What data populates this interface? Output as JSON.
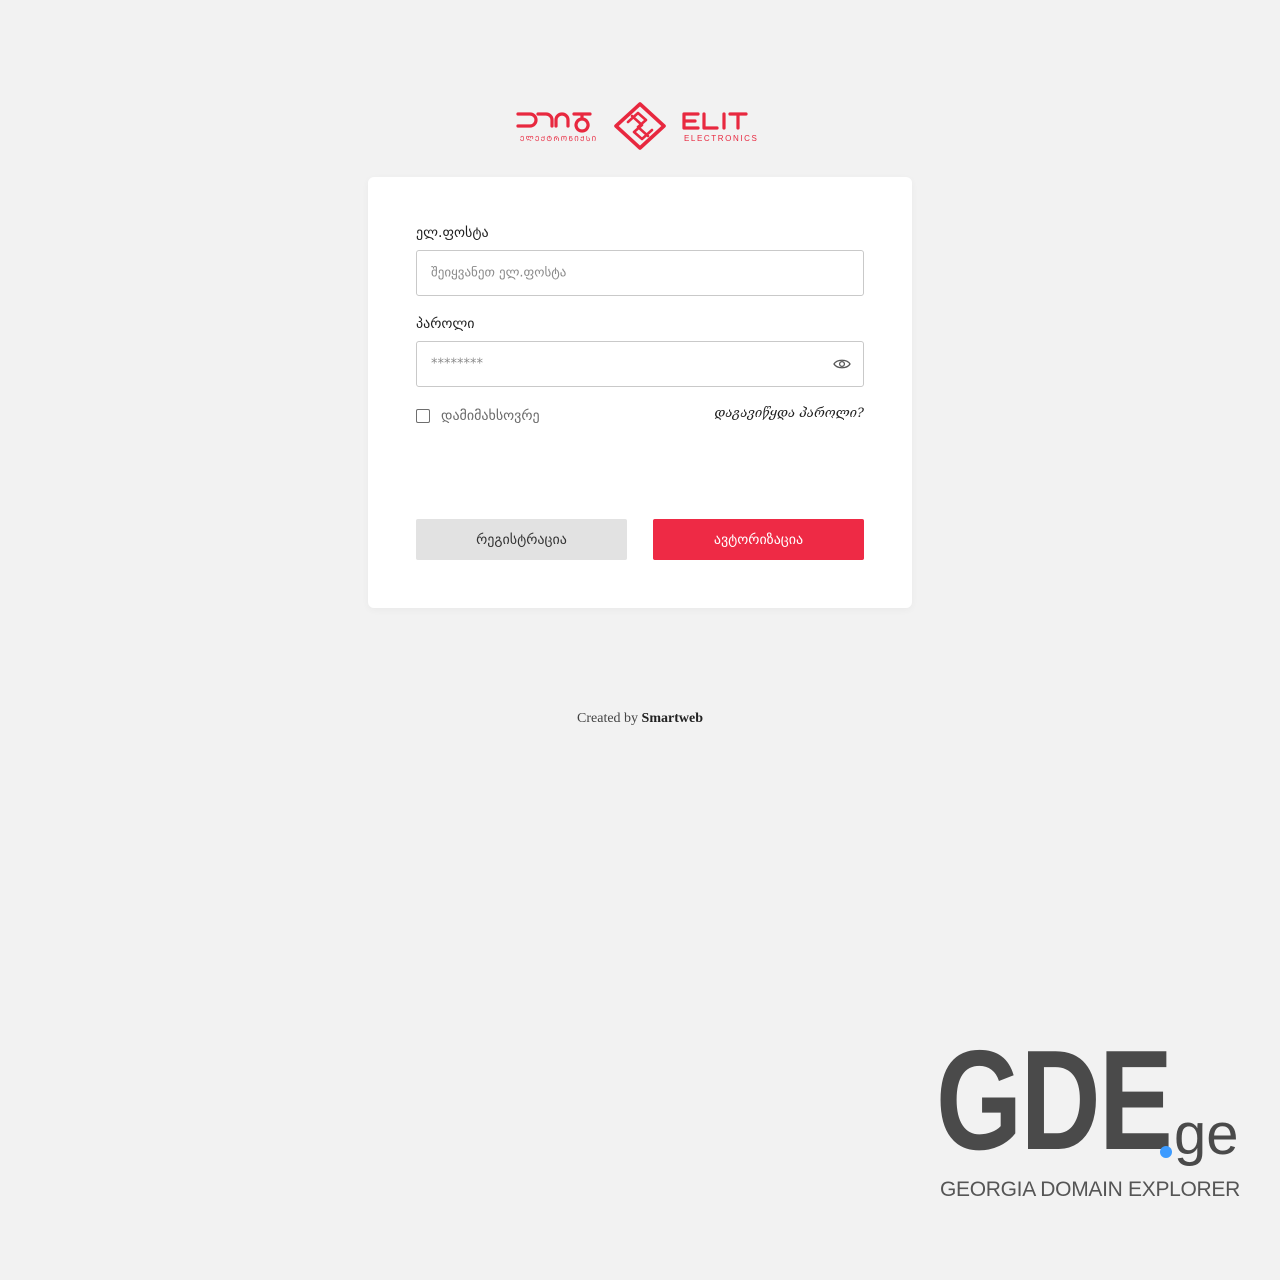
{
  "brand": {
    "logo_georgian": "ელიტ",
    "logo_georgian_sub": "ელექტრონიქსი",
    "logo_latin": "ELIT",
    "logo_latin_sub": "ELECTRONICS",
    "accent_color": "#e8283f"
  },
  "form": {
    "email_label": "ელ.ფოსტა",
    "email_placeholder": "შეიყვანეთ ელ.ფოსტა",
    "password_label": "პაროლი",
    "password_placeholder": "********",
    "password_toggle_icon": "eye-icon",
    "remember_label": "დამიმახსოვრე",
    "remember_checked": false,
    "forgot_link": "დაგავიწყდა პაროლი?",
    "register_button": "რეგისტრაცია",
    "login_button": "ავტორიზაცია",
    "login_button_color": "#ee2a45"
  },
  "footer": {
    "created_by": "Created by",
    "company": "Smartweb"
  },
  "watermark": {
    "main": "GDE",
    "tld": "ge",
    "subtitle": "GEORGIA DOMAIN EXPLORER"
  }
}
